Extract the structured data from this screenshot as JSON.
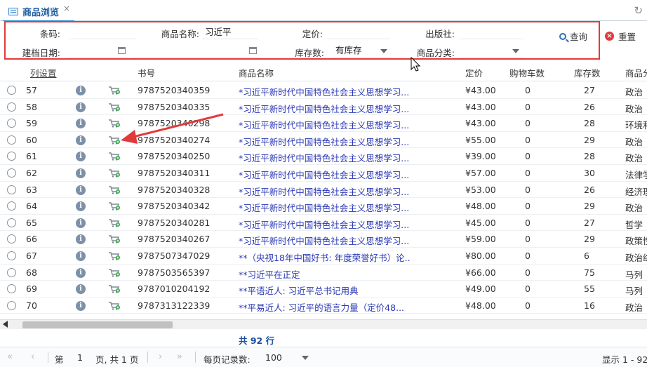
{
  "tab": {
    "title": "商品浏览",
    "close": "×"
  },
  "search": {
    "barcode_label": "条码:",
    "barcode_value": "",
    "name_label": "商品名称:",
    "name_value": "习近平",
    "price_label": "定价:",
    "price_value": "",
    "publisher_label": "出版社:",
    "publisher_value": "",
    "date_label": "建档日期:",
    "date_from": "",
    "date_to": "",
    "stock_label": "库存数:",
    "stock_value": "有库存",
    "category_label": "商品分类:",
    "category_value": "",
    "query_button": "查询",
    "reset_button": "重置"
  },
  "grid": {
    "columns": {
      "settings": "列设置",
      "isbn": "书号",
      "name": "商品名称",
      "price": "定价",
      "cart": "购物车数",
      "stock": "库存数",
      "category": "商品分"
    },
    "rows": [
      {
        "num": "57",
        "isbn": "9787520340359",
        "name": "*习近平新时代中国特色社会主义思想学习...",
        "price": "¥43.00",
        "cart": "0",
        "stock": "27",
        "category": "政治"
      },
      {
        "num": "58",
        "isbn": "9787520340335",
        "name": "*习近平新时代中国特色社会主义思想学习...",
        "price": "¥43.00",
        "cart": "0",
        "stock": "26",
        "category": "政治"
      },
      {
        "num": "59",
        "isbn": "9787520340298",
        "name": "*习近平新时代中国特色社会主义思想学习...",
        "price": "¥43.00",
        "cart": "0",
        "stock": "28",
        "category": "环境和"
      },
      {
        "num": "60",
        "isbn": "9787520340274",
        "name": "*习近平新时代中国特色社会主义思想学习...",
        "price": "¥55.00",
        "cart": "0",
        "stock": "29",
        "category": "政治"
      },
      {
        "num": "61",
        "isbn": "9787520340250",
        "name": "*习近平新时代中国特色社会主义思想学习...",
        "price": "¥39.00",
        "cart": "0",
        "stock": "28",
        "category": "政治"
      },
      {
        "num": "62",
        "isbn": "9787520340311",
        "name": "*习近平新时代中国特色社会主义思想学习...",
        "price": "¥57.00",
        "cart": "0",
        "stock": "30",
        "category": "法律学"
      },
      {
        "num": "63",
        "isbn": "9787520340328",
        "name": "*习近平新时代中国特色社会主义思想学习...",
        "price": "¥53.00",
        "cart": "0",
        "stock": "26",
        "category": "经济理"
      },
      {
        "num": "64",
        "isbn": "9787520340342",
        "name": "*习近平新时代中国特色社会主义思想学习...",
        "price": "¥48.00",
        "cart": "0",
        "stock": "29",
        "category": "政治"
      },
      {
        "num": "65",
        "isbn": "9787520340281",
        "name": "*习近平新时代中国特色社会主义思想学习...",
        "price": "¥45.00",
        "cart": "0",
        "stock": "27",
        "category": "哲学"
      },
      {
        "num": "66",
        "isbn": "9787520340267",
        "name": "*习近平新时代中国特色社会主义思想学习...",
        "price": "¥59.00",
        "cart": "0",
        "stock": "29",
        "category": "政策性"
      },
      {
        "num": "67",
        "isbn": "9787507347029",
        "name": "**（央视18年中国好书: 年度荣誉好书）论...",
        "price": "¥80.00",
        "cart": "0",
        "stock": "6",
        "category": "政治综"
      },
      {
        "num": "68",
        "isbn": "9787503565397",
        "name": "**习近平在正定",
        "price": "¥66.00",
        "cart": "0",
        "stock": "75",
        "category": "马列"
      },
      {
        "num": "69",
        "isbn": "9787010204192",
        "name": "**平语近人: 习近平总书记用典",
        "price": "¥49.00",
        "cart": "0",
        "stock": "55",
        "category": "马列"
      },
      {
        "num": "70",
        "isbn": "9787313122339",
        "name": "**平易近人: 习近平的语言力量（定价48...",
        "price": "¥48.00",
        "cart": "0",
        "stock": "16",
        "category": "政治"
      }
    ]
  },
  "total": "共 92 行",
  "pager": {
    "page_prefix": "第",
    "page_value": "1",
    "page_suffix": "页, 共 1 页",
    "page_size_label": "每页记录数:",
    "page_size_value": "100",
    "display": "显示 1 - 92"
  },
  "icons": {
    "tab": "list-icon",
    "close": "close-icon",
    "refresh": "refresh-icon",
    "calendar": "calendar-icon",
    "query": "search-icon",
    "reset": "cancel-icon",
    "info": "info-icon",
    "cart": "cart-add-icon"
  },
  "colors": {
    "accent": "#3a8bd1",
    "highlight_box": "#e23a3a",
    "link": "#2a37b4",
    "total": "#1a4fa0"
  }
}
